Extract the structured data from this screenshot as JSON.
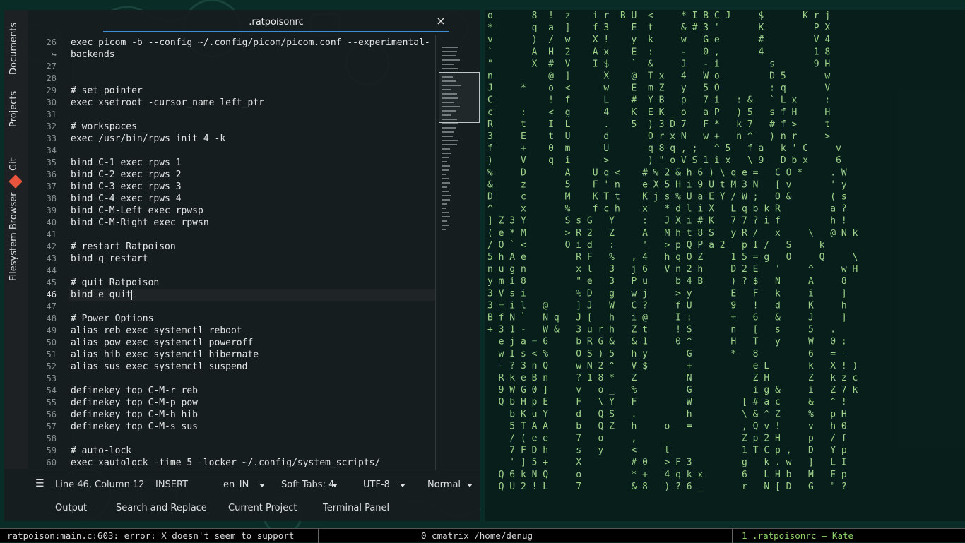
{
  "editor": {
    "tab_title": ".ratpoisonrc",
    "close_glyph": "×",
    "lines": [
      {
        "n": "26",
        "t": "exec picom -b --config ~/.config/picom/picom.conf --experimental-"
      },
      {
        "n": "↪",
        "t": "backends"
      },
      {
        "n": "27",
        "t": ""
      },
      {
        "n": "28",
        "t": ""
      },
      {
        "n": "29",
        "t": "# set pointer"
      },
      {
        "n": "30",
        "t": "exec xsetroot -cursor_name left_ptr"
      },
      {
        "n": "31",
        "t": ""
      },
      {
        "n": "32",
        "t": "# workspaces"
      },
      {
        "n": "33",
        "t": "exec /usr/bin/rpws init 4 -k"
      },
      {
        "n": "34",
        "t": ""
      },
      {
        "n": "35",
        "t": "bind C-1 exec rpws 1"
      },
      {
        "n": "36",
        "t": "bind C-2 exec rpws 2"
      },
      {
        "n": "37",
        "t": "bind C-3 exec rpws 3"
      },
      {
        "n": "38",
        "t": "bind C-4 exec rpws 4"
      },
      {
        "n": "39",
        "t": "bind C-M-Left exec rpwsp"
      },
      {
        "n": "40",
        "t": "bind C-M-Right exec rpwsn"
      },
      {
        "n": "41",
        "t": ""
      },
      {
        "n": "42",
        "t": "# restart Ratpoison"
      },
      {
        "n": "43",
        "t": "bind q restart"
      },
      {
        "n": "44",
        "t": ""
      },
      {
        "n": "45",
        "t": "# quit Ratpoison"
      },
      {
        "n": "46",
        "t": "bind e quit"
      },
      {
        "n": "47",
        "t": ""
      },
      {
        "n": "48",
        "t": "# Power Options"
      },
      {
        "n": "49",
        "t": "alias reb exec systemctl reboot"
      },
      {
        "n": "50",
        "t": "alias pow exec systemctl poweroff"
      },
      {
        "n": "51",
        "t": "alias hib exec systemctl hibernate"
      },
      {
        "n": "52",
        "t": "alias sus exec systemctl suspend"
      },
      {
        "n": "53",
        "t": ""
      },
      {
        "n": "54",
        "t": "definekey top C-M-r reb"
      },
      {
        "n": "55",
        "t": "definekey top C-M-p pow"
      },
      {
        "n": "56",
        "t": "definekey top C-M-h hib"
      },
      {
        "n": "57",
        "t": "definekey top C-M-s sus"
      },
      {
        "n": "58",
        "t": ""
      },
      {
        "n": "59",
        "t": "# auto-lock"
      },
      {
        "n": "60",
        "t": "exec xautolock -time 5 -locker ~/.config/system_scripts/"
      }
    ],
    "current_line_index": 21
  },
  "sidebar": {
    "documents": "Documents",
    "projects": "Projects",
    "git": "Git",
    "filesystem": "Filesystem Browser"
  },
  "status": {
    "position": "Line 46, Column 12",
    "mode": "INSERT",
    "language": "en_IN",
    "indent": "Soft Tabs: 4",
    "encoding": "UTF-8",
    "input_mode": "Normal"
  },
  "toolbar": {
    "output": "Output",
    "search": "Search and Replace",
    "project": "Current Project",
    "terminal": "Terminal Panel"
  },
  "bottombar": {
    "error": "ratpoison:main.c:603: error: X doesn't seem to support",
    "window0": "0 cmatrix  /home/denug",
    "window1": "1 .ratpoisonrc  — Kate"
  },
  "matrix": {
    "rows": [
      "o       8  !  z    i r  B U  <     * I B C J     $       K r j",
      "*       q  a  ]    f 3    E  t     & # 3 '       K         P X",
      "v       )  /  w    X !    y  k     w   G e       #         V 4",
      "`       A  H  2    A x    E  :     -   0 ,       4         1 8",
      "\"       X  #  V    I $    `  &     J   - i         s       9 H",
      "n          @  ]      X    @  T x   4   W o         D 5       w",
      "J     *    o  <      w    E  m Z   y   5 O         : q       V",
      "C          !  f      L    #  Y B   p   7 i   : &   ` L x     :",
      "c     :    <  g      4    K  E K _ o   a P   ) 5   s f H     H",
      "R     t    I  L      .    5  ) 3 D 7   F *   k 7   # f >     t",
      "3     E    t  U      d       O r x N   w +   n ^   ) n r     >",
      "f     +    0  m      U       q 8 q , ;   ^ 5   f a   k ' C     v",
      ")     V    q  i      >       ) \" o V S 1 i x   \\ 9   D b x     6",
      "%     D       A    U q <    # % 2 & h 6 ) \\ q e =   C O *     . W",
      "&     z       5    F ' n    e X 5 H i 9 U t M 3 N   [ v       ' y",
      "D     c       M    K T t    K j s % U a E Y / W ;   O &       ( s",
      "^     x       %    f c h    x   * d l i X   L q b k R         a ?",
      "] Z 3 Y       S s G   Y     :   J X i # K   7 7 ? i f         h !",
      "( e * M       > R 2   Z     A   M h t 8 S   y R /   x     \\   @ N k",
      "/ O ` <       O i d   :     '   > p Q P a 2   p I /   S     k",
      "5 h A e         R F   %   , 4   h q O Z     1 5 = g   O     Q     \\",
      "n u g n         x l   3   j 6   V n 2 h     D 2 E   '     ^     w H",
      "y m i 8         \" e   3   P u     b 4 B     ) ? $   N     A     8",
      "3 V s i         % D   g   w j     > y       E   F   k     i     ]",
      "3 = i l   @     ] J   W   C ?     f U       9   !   d     K     h",
      "B f N `   N q   J [   h   i @     I :       =   6   &     J     ]",
      "+ 3 1 -   W &   3 u r h   Z t     ! S       n   [   s     5   .",
      "  e j a = 6     b R G &   & 1     0 ^       H   T   y     W   0 :",
      "  w I s < %     O S ) 5   h y       G       *   8         6   = -",
      "  - ? 3 n Q     w N 2 ^   V $       +           e L       k   X ! )",
      "  R k e B n     ? 1 8 *   Z         N           Z H       Z   k z c",
      "  9 W G 0 ]     v   o _   %         G           i g &     i   Z 7 k",
      "  Q b H p E     F   \\ Y   F         W         [ # a c     &   ^ !",
      "    b K u Y     d   Q S   .         h         \\ & ^ Z     %   p H",
      "    5 T A A     b   Q Z   h     o   =         , Q v !     v   h 0",
      "    / ( e e     7   o     ,     _             Z p 2 H     p   / f",
      "    7 F D h     s   y     <     t             1 T C p ,   D   Y p",
      "    ' ] 5 +     X         # 0   > F 3         g   k . w   ]   L I",
      "  Q 6 k N Q     o         * +   4 q k x       6   L H b   M   E p",
      "  Q U 2 ! L     7         & 8   ) ? 6 _       r   N [ D   G   \" ?"
    ]
  }
}
